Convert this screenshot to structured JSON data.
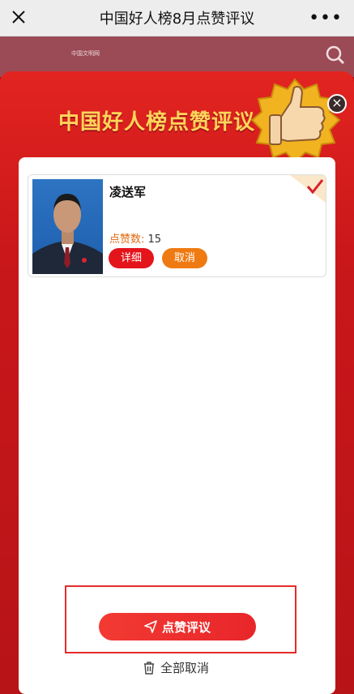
{
  "topbar": {
    "title": "中国好人榜8月点赞评议",
    "more_label": "•••"
  },
  "logo_text": "中国文明网",
  "modal": {
    "headline": "中国好人榜点赞评议",
    "close_label": "×"
  },
  "candidate": {
    "name": "凌送军",
    "likes_label": "点赞数:",
    "likes_value": "15",
    "detail_label": "详细",
    "cancel_label": "取消",
    "selected": true
  },
  "actions": {
    "submit_label": "点赞评议",
    "clear_label": "全部取消"
  },
  "colors": {
    "primary_red": "#e4141b",
    "orange": "#ef7a12",
    "gold": "#ffd55a"
  },
  "icons": [
    "close-icon",
    "more-icon",
    "search-icon",
    "thumbs-up-icon",
    "check-icon",
    "send-icon",
    "trash-icon"
  ]
}
